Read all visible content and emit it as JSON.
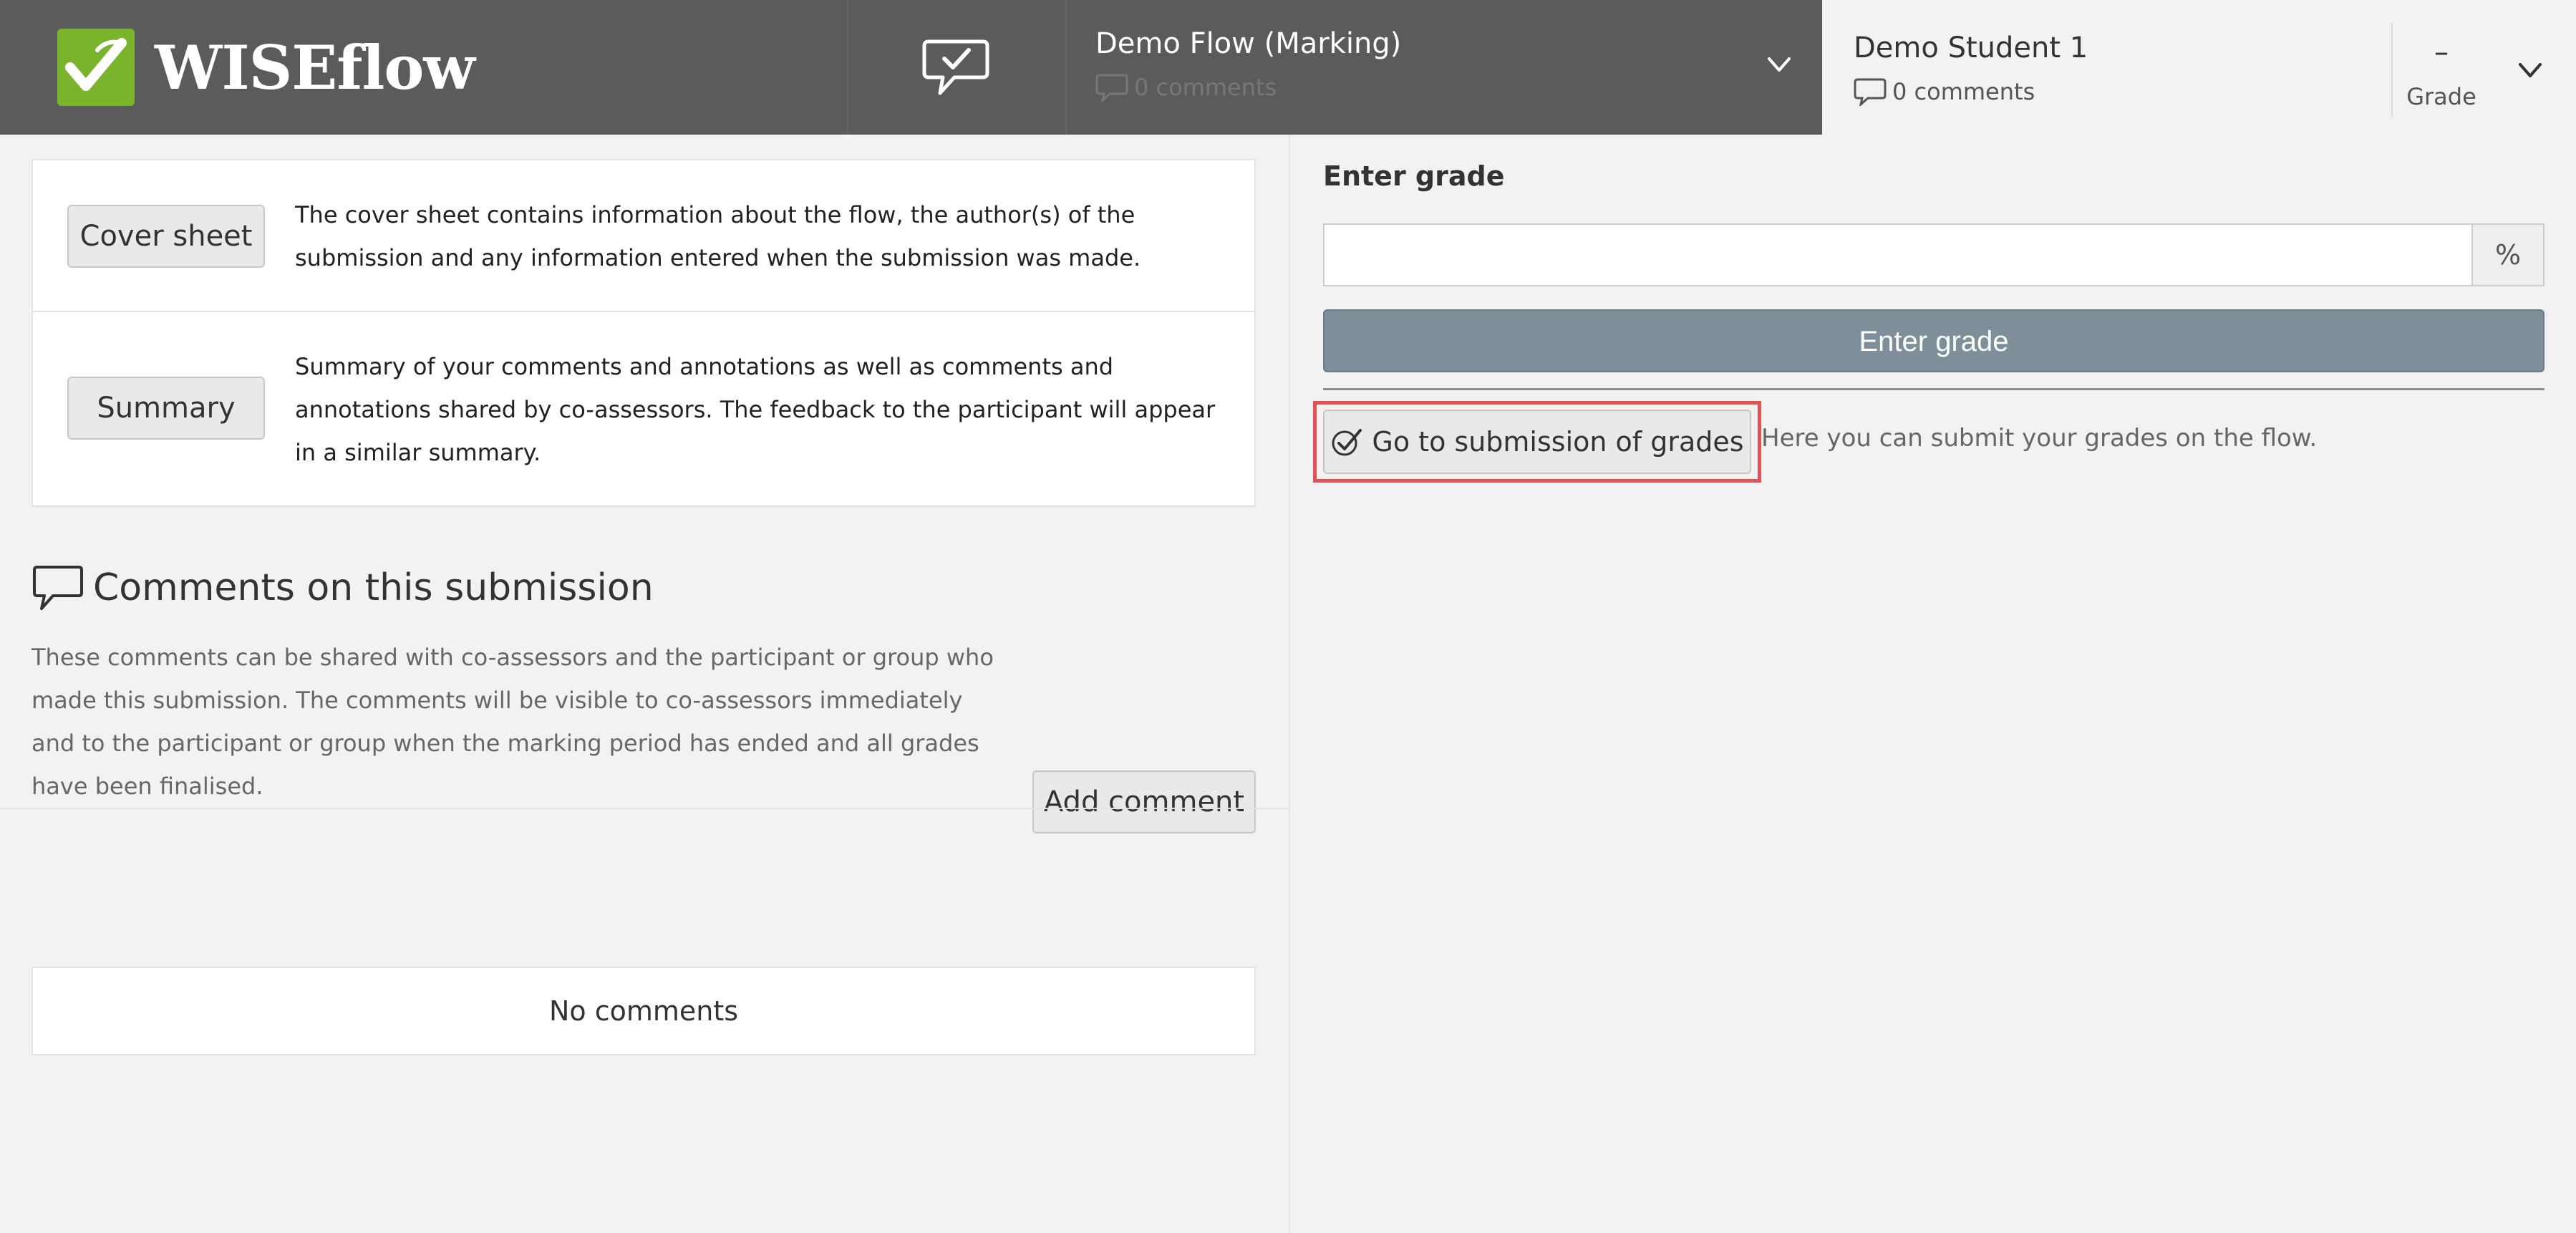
{
  "header": {
    "brand": "WISEflow",
    "flow": {
      "title": "Demo Flow (Marking)",
      "comments": "0 comments"
    },
    "student": {
      "name": "Demo Student 1",
      "comments": "0 comments"
    },
    "grade": {
      "value": "–",
      "label": "Grade"
    }
  },
  "info_items": [
    {
      "button": "Cover sheet",
      "text": "The cover sheet contains information about the flow, the author(s) of the submission and any information entered when the submission was made."
    },
    {
      "button": "Summary",
      "text": "Summary of your comments and annotations as well as comments and annotations shared by co-assessors. The feedback to the participant will appear in a similar summary."
    }
  ],
  "comments_section": {
    "title": "Comments on this submission",
    "description": "These comments can be shared with co-assessors and the participant or group who made this submission. The comments will be visible to co-assessors immediately and to the participant or group when the marking period has ended and all grades have been finalised.",
    "add_button": "Add comment",
    "empty_text": "No comments"
  },
  "grading": {
    "label": "Enter grade",
    "input_value": "",
    "unit": "%",
    "enter_button": "Enter grade",
    "submit_button": "Go to submission of grades",
    "submit_help": "Here you can submit your grades on the flow."
  },
  "colors": {
    "topbar": "#5b5b5b",
    "logo_green": "#7ab42c",
    "enter_button": "#7f8f9a",
    "highlight": "#e35252"
  }
}
